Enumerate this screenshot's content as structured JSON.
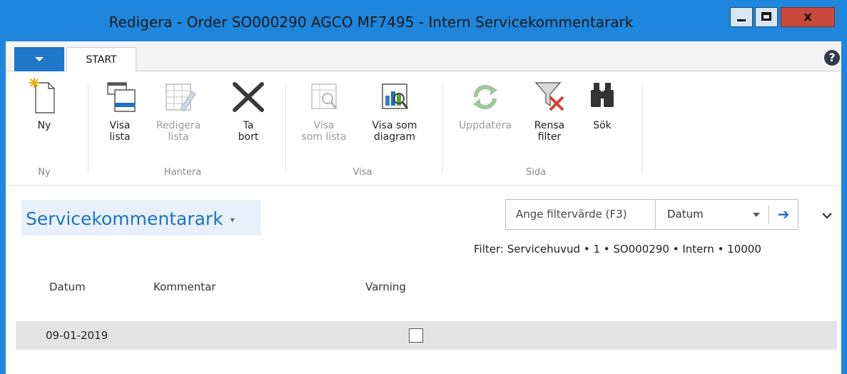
{
  "window": {
    "title": "Redigera - Order SO000290 AGCO MF7495 - Intern Servicekommentarark",
    "close_label": "x"
  },
  "tabs": {
    "start_label": "START",
    "help_label": "?"
  },
  "ribbon": {
    "groups": [
      {
        "label": "Ny"
      },
      {
        "label": "Hantera"
      },
      {
        "label": "Visa"
      },
      {
        "label": "Sida"
      }
    ],
    "buttons": {
      "ny": {
        "label": "Ny",
        "icon": "new-document-icon",
        "enabled": true
      },
      "visa_lista": {
        "label": "Visa\nlista",
        "icon": "view-list-icon",
        "enabled": true
      },
      "redigera_lista": {
        "label": "Redigera\nlista",
        "icon": "edit-list-icon",
        "enabled": false
      },
      "ta_bort": {
        "label": "Ta\nbort",
        "icon": "delete-x-icon",
        "enabled": true
      },
      "visa_som_lista": {
        "label": "Visa\nsom lista",
        "icon": "view-as-list-icon",
        "enabled": false
      },
      "visa_som_diagram": {
        "label": "Visa som\ndiagram",
        "icon": "view-as-chart-icon",
        "enabled": true
      },
      "uppdatera": {
        "label": "Uppdatera",
        "icon": "refresh-icon",
        "enabled": false
      },
      "rensa_filter": {
        "label": "Rensa\nfilter",
        "icon": "clear-filter-icon",
        "enabled": true
      },
      "sok": {
        "label": "Sök",
        "icon": "binoculars-icon",
        "enabled": true
      }
    }
  },
  "page": {
    "title": "Servicekommentarark",
    "title_caret": "▾"
  },
  "filter": {
    "placeholder": "Ange filtervärde (F3)",
    "field": "Datum",
    "go_arrow": "➔",
    "active_filter": "Filter: Servicehuvud • 1 • SO000290 • Intern • 10000"
  },
  "table": {
    "columns": [
      "Datum",
      "Kommentar",
      "Varning"
    ],
    "rows": [
      {
        "datum": "09-01-2019",
        "kommentar": "",
        "varning": false
      }
    ]
  },
  "colors": {
    "titlebar": "#1e86dc",
    "accent": "#1e72c0",
    "close_button": "#c9483a",
    "selected_row": "#e3e3e3"
  }
}
